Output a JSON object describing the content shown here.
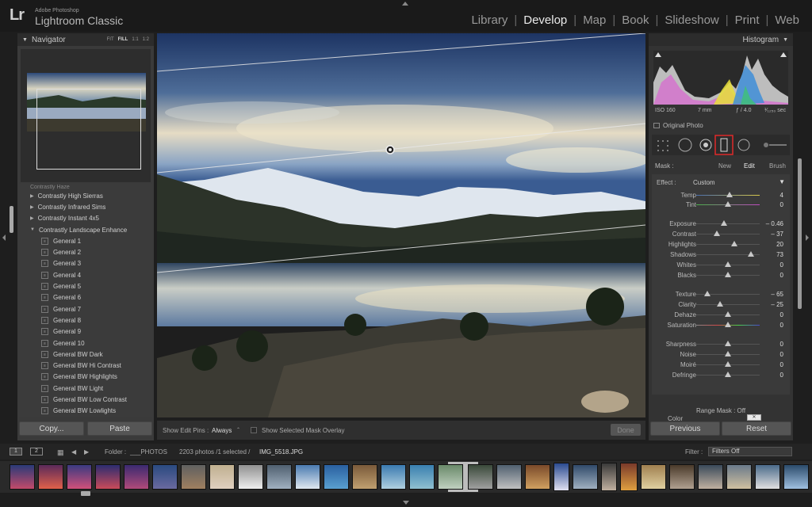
{
  "app": {
    "logo": "Lr",
    "brand_small": "Adobe Photoshop",
    "brand_big": "Lightroom Classic"
  },
  "modules": [
    "Library",
    "Develop",
    "Map",
    "Book",
    "Slideshow",
    "Print",
    "Web"
  ],
  "active_module": "Develop",
  "navigator": {
    "title": "Navigator",
    "zoom_fit": "FIT",
    "zoom_fill": "FILL",
    "zoom_1": "1:1",
    "zoom_2": "1:2"
  },
  "presets": {
    "cut_top": "Contrastly Haze",
    "folders": [
      "Contrastly High Sierras",
      "Contrastly Infrared Sims",
      "Contrastly Instant 4x5",
      "Contrastly Landscape Enhance"
    ],
    "items": [
      "General 1",
      "General 2",
      "General 3",
      "General 4",
      "General 5",
      "General 6",
      "General 7",
      "General 8",
      "General 9",
      "General 10",
      "General BW Dark",
      "General BW Hi Contrast",
      "General BW Highlights",
      "General BW Light",
      "General BW Low Contrast",
      "General BW Lowlights"
    ]
  },
  "left_buttons": {
    "copy": "Copy...",
    "paste": "Paste"
  },
  "histogram": {
    "title": "Histogram",
    "iso": "ISO 160",
    "focal": "7 mm",
    "aperture": "ƒ / 4.0",
    "shutter": "¹⁄₁₂₅₀ sec",
    "original_photo": "Original Photo"
  },
  "mask": {
    "label": "Mask :",
    "new": "New",
    "edit": "Edit",
    "brush": "Brush"
  },
  "effect": {
    "label": "Effect :",
    "value": "Custom"
  },
  "adjustments": [
    {
      "label": "Temp",
      "value": "4",
      "pos": 0.52
    },
    {
      "label": "Tint",
      "value": "0",
      "pos": 0.5
    },
    {
      "label": "Exposure",
      "value": "– 0.46",
      "pos": 0.44
    },
    {
      "label": "Contrast",
      "value": "– 37",
      "pos": 0.32
    },
    {
      "label": "Highlights",
      "value": "20",
      "pos": 0.6
    },
    {
      "label": "Shadows",
      "value": "73",
      "pos": 0.86
    },
    {
      "label": "Whites",
      "value": "0",
      "pos": 0.5
    },
    {
      "label": "Blacks",
      "value": "0",
      "pos": 0.5
    },
    {
      "label": "Texture",
      "value": "– 65",
      "pos": 0.17
    },
    {
      "label": "Clarity",
      "value": "– 25",
      "pos": 0.37
    },
    {
      "label": "Dehaze",
      "value": "0",
      "pos": 0.5
    },
    {
      "label": "Saturation",
      "value": "0",
      "pos": 0.5
    },
    {
      "label": "Sharpness",
      "value": "0",
      "pos": 0.5
    },
    {
      "label": "Noise",
      "value": "0",
      "pos": 0.5
    },
    {
      "label": "Moiré",
      "value": "0",
      "pos": 0.5
    },
    {
      "label": "Defringe",
      "value": "0",
      "pos": 0.5
    }
  ],
  "color_label": "Color",
  "range_mask": "Range Mask : Off",
  "right_buttons": {
    "previous": "Previous",
    "reset": "Reset"
  },
  "toolbar": {
    "edit_pins_label": "Show Edit Pins :",
    "edit_pins_value": "Always",
    "mask_overlay": "Show Selected Mask Overlay",
    "done": "Done"
  },
  "filmstrip": {
    "page1": "1",
    "page2": "2",
    "folder_label": "Folder :",
    "folder_name": "___PHOTOS",
    "count": "2203 photos /1 selected /",
    "filename": "IMG_5518.JPG",
    "filter_label": "Filter :",
    "filter_value": "Filters Off"
  }
}
